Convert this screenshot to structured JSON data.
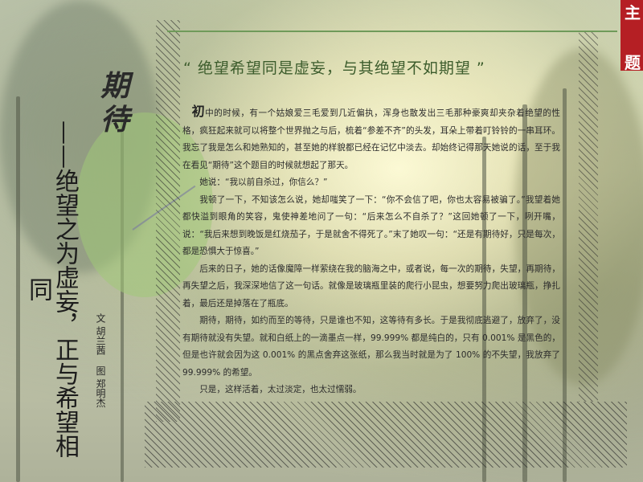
{
  "corner_tab": {
    "char_top": "主",
    "char_bottom": "题"
  },
  "heading": {
    "char1": "期",
    "char2": "待"
  },
  "vertical_title": "——绝望之为虚妄，正与希望相同",
  "credit": {
    "author": "文 胡兰茜",
    "illustrator": "图 郑明杰"
  },
  "quote": "“ 绝望希望同是虚妄，与其绝望不如期望 ”",
  "article": {
    "dropcap": "初",
    "paragraphs": [
      "中的时候，有一个姑娘爱三毛爱到几近偏执，浑身也散发出三毛那种豪爽却夹杂着绝望的性格，疯狂起来就可以将整个世界抛之与后，梳着“参差不齐”的头发，耳朵上带着叮铃铃的一串耳环。我忘了我是怎么和她熟知的，甚至她的样貌都已经在记忆中淡去。却始终记得那天她说的话，至于我在看见“期待”这个题目的时候就想起了那天。",
      "她说：“我以前自杀过，你信么？”",
      "我顿了一下，不知该怎么说，她却嗤笑了一下：“你不会信了吧，你也太容易被骗了。”我望着她都快溢到眼角的笑容，鬼使神差地问了一句：“后来怎么不自杀了？”这回她顿了一下，咧开嘴，说：“我后来想到晚饭是红烧茄子，于是就舍不得死了。”末了她叹一句：“还是有期待好，只是每次，都是恐惧大于惊喜。”",
      "后来的日子，她的话像魔障一样萦绕在我的脑海之中，或者说，每一次的期待，失望，再期待，再失望之后，我深深地信了这一句话。就像是玻璃瓶里装的爬行小昆虫，想要努力爬出玻璃瓶，挣扎着，最后还是掉落在了瓶底。",
      "期待，期待，如约而至的等待，只是谁也不知，这等待有多长。于是我彻底逃避了，放弃了，没有期待就没有失望。就和白纸上的一滴墨点一样，99.999% 都是纯白的，只有 0.001% 是黑色的，但是也许就会因为这 0.001% 的黑点舍弃这张纸，那么我当时就是为了 100% 的不失望，我放弃了 99.999% 的希望。",
      "只是，这样活着，太过淡定，也太过懦弱。"
    ]
  },
  "colors": {
    "accent_red": "#b51f24",
    "quote_green": "#3c5c2c",
    "line_green": "#6f9a5a"
  }
}
